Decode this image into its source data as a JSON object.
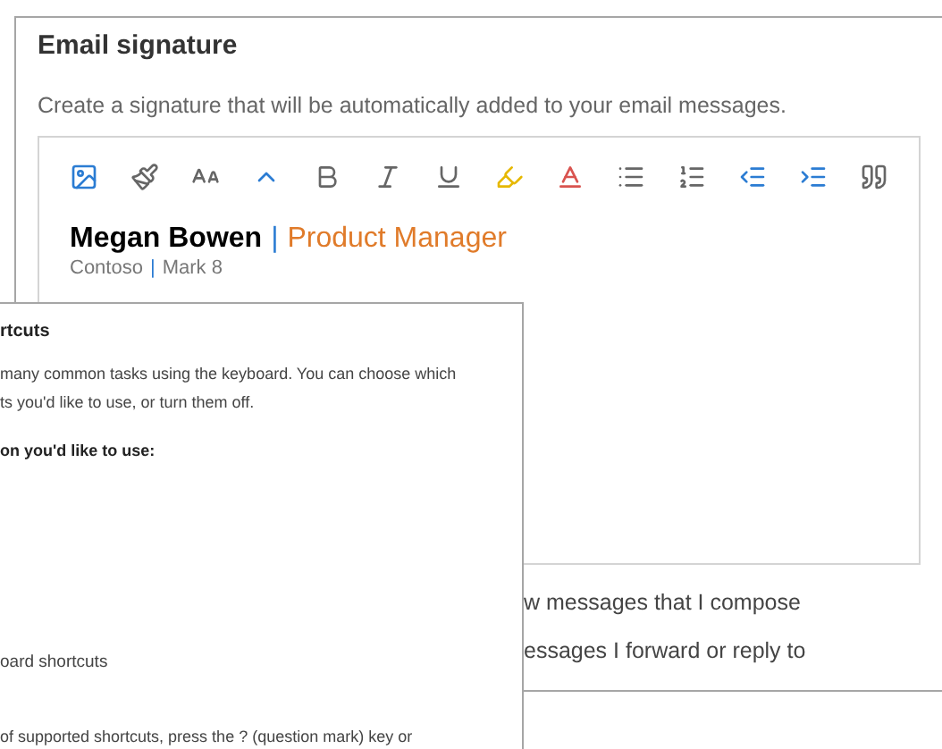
{
  "signature_settings": {
    "title": "Email signature",
    "description": "Create a signature that will be automatically added to your email messages.",
    "signature_lines": [
      {
        "kind": "name",
        "first": "Megan Bowen",
        "separator": "|",
        "second": "Product Manager"
      },
      {
        "kind": "company",
        "first": "Contoso",
        "separator": "|",
        "second": "Mark 8"
      }
    ],
    "options": [
      "w messages that I compose",
      "essages I forward or reply to"
    ]
  },
  "shortcuts_panel": {
    "title": "rtcuts",
    "intro_lines": [
      "many common tasks using the keyboard. You can choose which",
      "ts you'd like to use, or turn them off."
    ],
    "prompt": "on you'd like to use:",
    "option": "oard shortcuts",
    "hint": "of supported shortcuts, press the ? (question mark) key or"
  }
}
